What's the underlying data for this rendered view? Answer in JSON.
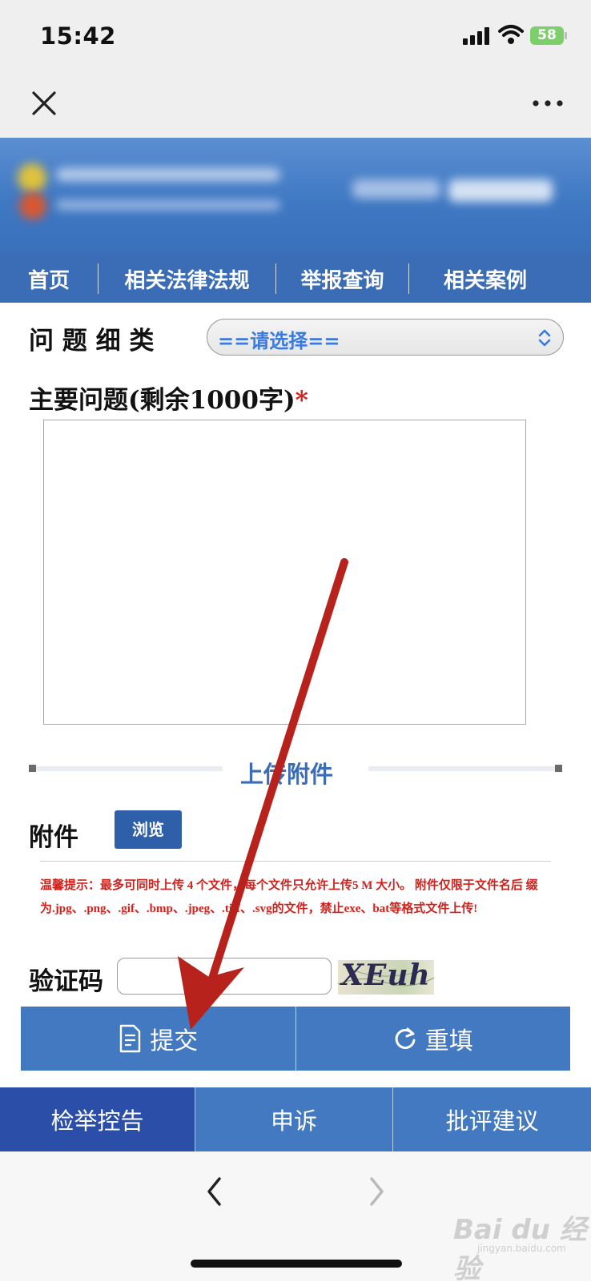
{
  "status_bar": {
    "time": "15:42",
    "battery": "58"
  },
  "nav": {
    "close_icon": "close-icon",
    "more_icon": "more-icon"
  },
  "top_menu": [
    "首页",
    "相关法律法规",
    "举报查询",
    "相关案例"
  ],
  "form": {
    "category_label": "问 题 细 类",
    "category_value": "==请选择==",
    "main_issue_label": "主要问题(剩余1000字)",
    "required_mark": "*",
    "main_issue_value": "",
    "upload_section_title": "上传附件",
    "attachment_label": "附件",
    "browse_button": "浏览",
    "notice": "温馨提示：最多可同时上传 4 个文件，每个文件只允许上传5 M 大小。 附件仅限于文件名后 缀为.jpg、.png、.gif、.bmp、.jpeg、.tiff、.svg的文件，禁止exe、bat等格式文件上传!",
    "captcha_label": "验证码",
    "captcha_value": "",
    "captcha_text": "XEuh",
    "submit_button": "提交",
    "reset_button": "重填"
  },
  "bottom_tabs": [
    {
      "label": "检举控告",
      "active": true
    },
    {
      "label": "申诉",
      "active": false
    },
    {
      "label": "批评建议",
      "active": false
    }
  ],
  "browser": {
    "back_icon": "back-icon",
    "forward_icon": "forward-icon"
  },
  "watermark": {
    "text": "Bai du 经验",
    "sub": "jingyan.baidu.com"
  },
  "colors": {
    "primary": "#4379c0",
    "active_tab": "#2b4fa8",
    "notice": "#d0211c",
    "arrow": "#b7231c"
  }
}
